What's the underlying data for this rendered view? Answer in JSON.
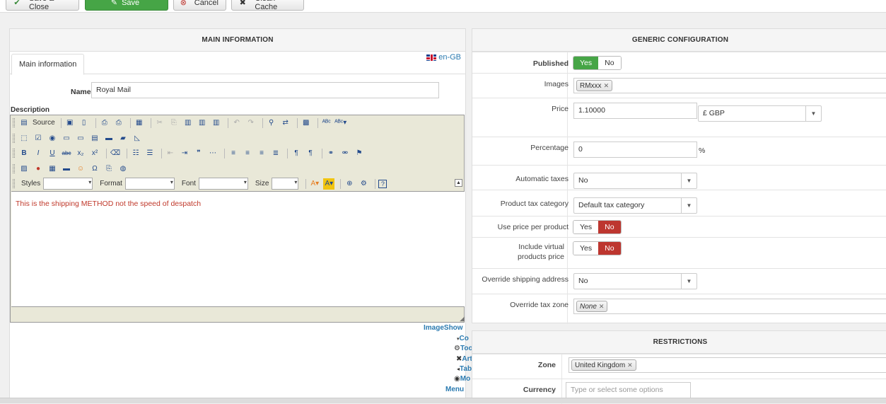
{
  "toolbar": {
    "save_close": "Save & Close",
    "save": "Save",
    "cancel": "Cancel",
    "clean_cache": "Clean Cache"
  },
  "main": {
    "title": "MAIN INFORMATION",
    "tab": "Main information",
    "language": "en-GB",
    "name_label": "Name",
    "name_value": "Royal Mail",
    "description_label": "Description",
    "source_label": "Source",
    "styles_label": "Styles",
    "format_label": "Format",
    "font_label": "Font",
    "size_label": "Size",
    "editor_text": "This is the shipping METHOD not the speed of despatch",
    "links": {
      "imageshow": "ImageShow",
      "co": "Co",
      "too": "Too",
      "art": "Art",
      "tab": "Tab",
      "mo": "Mo",
      "menu": "Menu"
    }
  },
  "generic": {
    "title": "GENERIC CONFIGURATION",
    "published_label": "Published",
    "yes": "Yes",
    "no": "No",
    "images_label": "Images",
    "images_chip": "RMxxx",
    "price_label": "Price",
    "price_value": "1.10000",
    "currency_value": "£ GBP",
    "percentage_label": "Percentage",
    "percentage_value": "0",
    "percent_sign": "%",
    "automatic_taxes_label": "Automatic taxes",
    "automatic_taxes_value": "No",
    "product_tax_label": "Product tax category",
    "product_tax_value": "Default tax category",
    "use_price_per_product_label": "Use price per product",
    "include_virtual_label": "Include virtual products price",
    "override_shipping_label": "Override shipping address",
    "override_shipping_value": "No",
    "override_tax_zone_label": "Override tax zone",
    "override_tax_zone_chip": "None"
  },
  "restrictions": {
    "title": "RESTRICTIONS",
    "zone_label": "Zone",
    "zone_chip": "United Kingdom",
    "currency_label": "Currency",
    "currency_placeholder": "Type or select some options"
  },
  "colors": {
    "green": "#46a546",
    "red": "#bd362f",
    "link": "#2a7ab0"
  }
}
